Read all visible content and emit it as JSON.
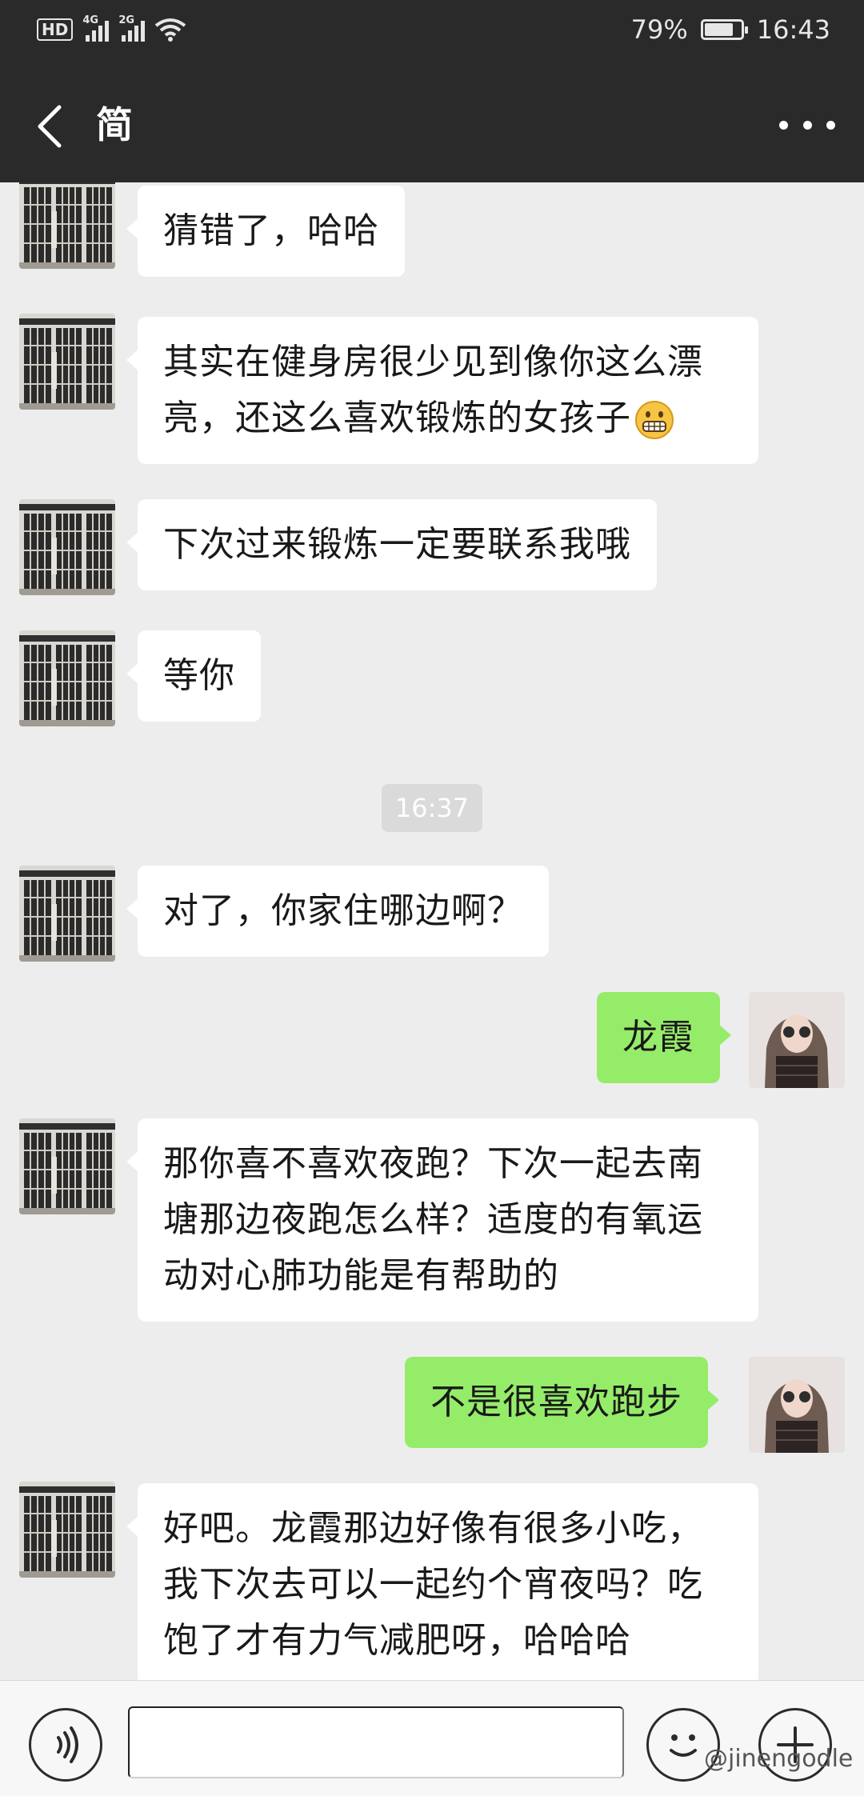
{
  "status_bar": {
    "hd": "HD",
    "network_1": "4G",
    "network_2": "2G",
    "battery": "79%",
    "battery_level": 0.79,
    "time": "16:43"
  },
  "header": {
    "title": "简"
  },
  "messages": [
    {
      "side": "left",
      "text": "猜错了，哈哈"
    },
    {
      "side": "left",
      "text": "其实在健身房很少见到像你这么漂亮，还这么喜欢锻炼的女孩子",
      "emoji": "grimace-emoji"
    },
    {
      "side": "left",
      "text": "下次过来锻炼一定要联系我哦"
    },
    {
      "side": "left",
      "text": "等你"
    },
    {
      "side": "left",
      "text": "对了，你家住哪边啊？"
    },
    {
      "side": "right",
      "text": "龙霞"
    },
    {
      "side": "left",
      "text": "那你喜不喜欢夜跑？下次一起去南塘那边夜跑怎么样？适度的有氧运动对心肺功能是有帮助的"
    },
    {
      "side": "right",
      "text": "不是很喜欢跑步"
    },
    {
      "side": "left",
      "text": "好吧。龙霞那边好像有很多小吃，我下次去可以一起约个宵夜吗？吃饱了才有力气减肥呀，哈哈哈"
    }
  ],
  "timestamp": "16:37",
  "input_bar": {
    "text_value": "",
    "voice_icon": "voice-icon",
    "emoji_icon": "emoji-icon",
    "plus_icon": "plus-icon"
  },
  "watermark": "@jinengodle"
}
